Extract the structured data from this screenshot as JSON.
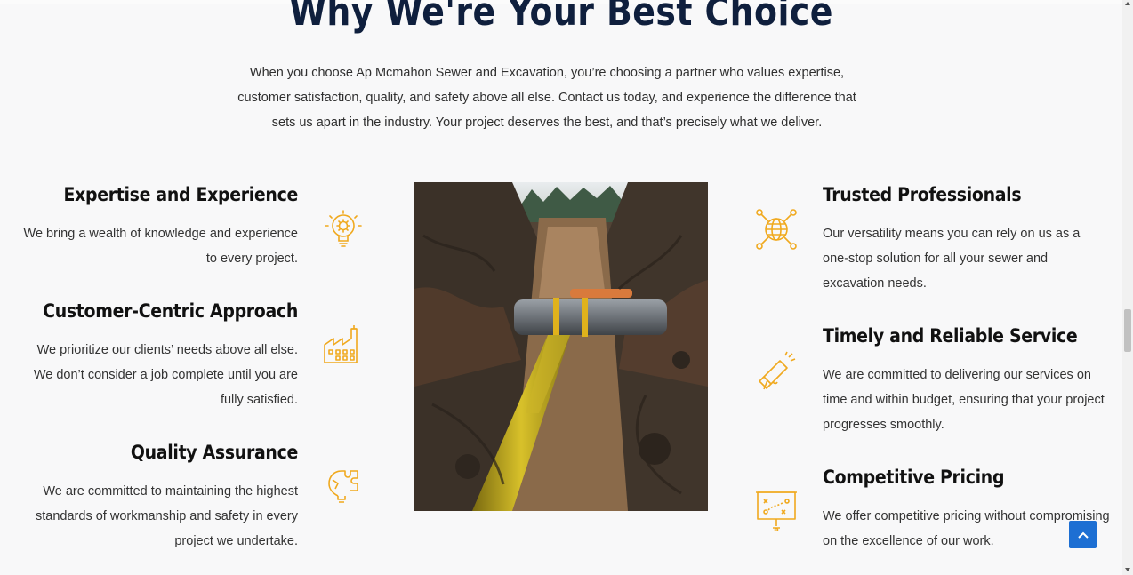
{
  "section": {
    "title": "Why We're Your Best Choice",
    "intro": "When you choose Ap Mcmahon Sewer and Excavation, you’re choosing a partner who values expertise, customer satisfaction, quality, and safety above all else. Contact us today, and experience the difference that sets us apart in the industry. Your project deserves the best, and that’s precisely what we deliver."
  },
  "left_features": [
    {
      "title": "Expertise and Experience",
      "text": "We bring a wealth of knowledge and experience to every project.",
      "icon": "lightbulb-gear-icon"
    },
    {
      "title": "Customer-Centric Approach",
      "text": "We prioritize our clients’ needs above all else. We don’t consider a job complete until you are fully satisfied.",
      "icon": "factory-icon"
    },
    {
      "title": "Quality Assurance",
      "text": "We are committed to maintaining the highest standards of workmanship and safety in every project we undertake.",
      "icon": "puzzle-bulb-icon"
    }
  ],
  "right_features": [
    {
      "title": "Trusted Professionals",
      "text": "Our versatility means you can rely on us as a one-stop solution for all your sewer and excavation needs.",
      "icon": "globe-network-icon"
    },
    {
      "title": "Timely and Reliable Service",
      "text": "We are committed to delivering our services on time and within budget, ensuring that your project progresses smoothly.",
      "icon": "megaphone-icon"
    },
    {
      "title": "Competitive Pricing",
      "text": "We offer competitive pricing without compromising on the excellence of our work.",
      "icon": "strategy-board-icon"
    }
  ],
  "image": {
    "subject": "excavated trench with pipes"
  },
  "colors": {
    "accent": "#f0a91e",
    "heading": "#0f1f3d",
    "button": "#1d6fd3"
  }
}
